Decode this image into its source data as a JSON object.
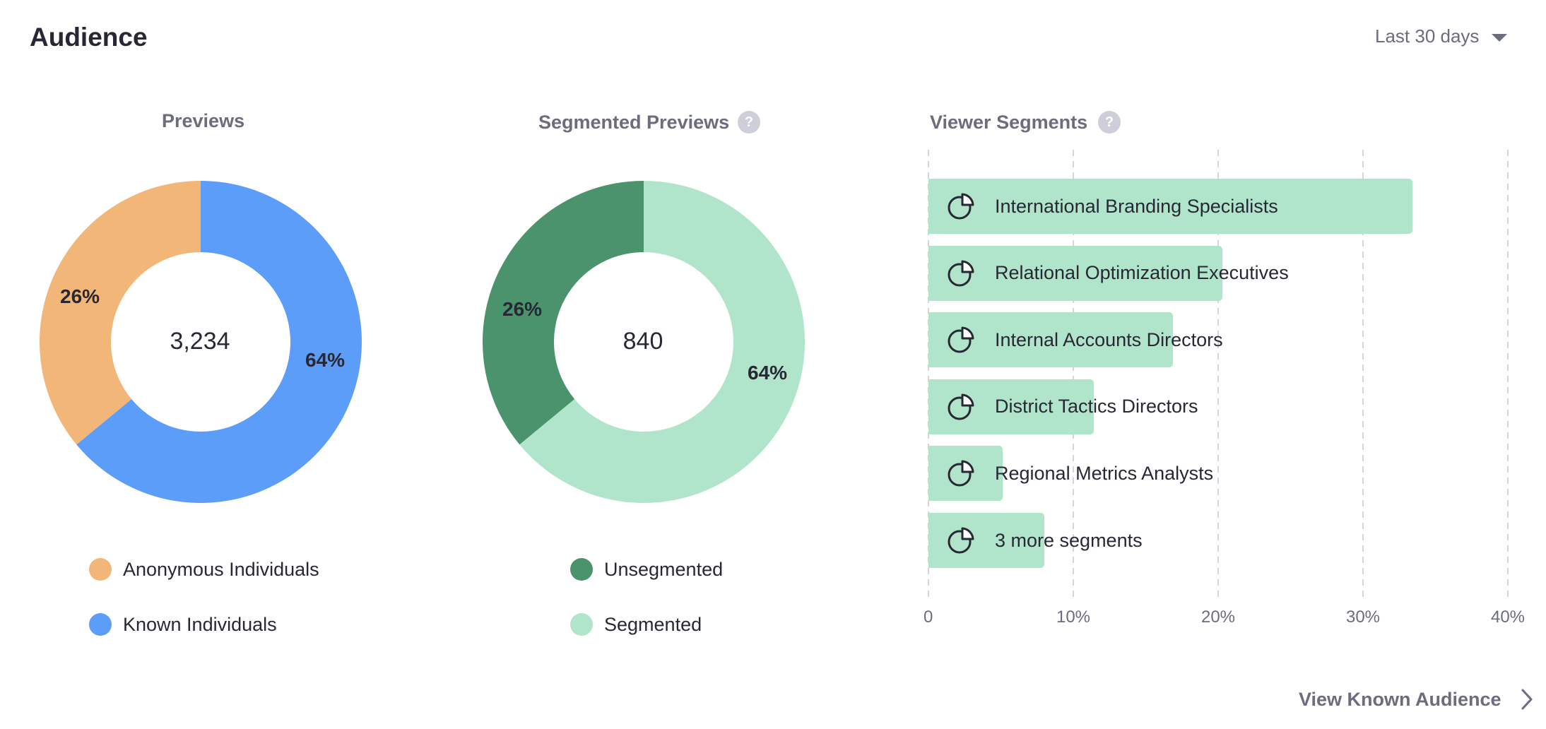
{
  "header": {
    "title": "Audience",
    "range_label": "Last 30 days"
  },
  "previews": {
    "title": "Previews",
    "total": "3,234",
    "slices": [
      {
        "name": "Anonymous Individuals",
        "label": "26%",
        "value": 36,
        "color": "#f3b679"
      },
      {
        "name": "Known Individuals",
        "label": "64%",
        "value": 64,
        "color": "#5c9dfa"
      }
    ]
  },
  "segmented": {
    "title": "Segmented Previews",
    "help": "?",
    "total": "840",
    "slices": [
      {
        "name": "Unsegmented",
        "label": "26%",
        "value": 36,
        "color": "#4b936c"
      },
      {
        "name": "Segmented",
        "label": "64%",
        "value": 64,
        "color": "#b0e5cc"
      }
    ]
  },
  "viewer_segments": {
    "title": "Viewer Segments",
    "help": "?",
    "bar_color": "#b0e5cc"
  },
  "chart_data": {
    "type": "bar",
    "orientation": "horizontal",
    "categories": [
      "International Branding Specialists",
      "Relational Optimization Executives",
      "Internal Accounts Directors",
      "District Tactics Directors",
      "Regional Metrics Analysts",
      "3 more segments"
    ],
    "values": [
      33.4,
      20.3,
      16.9,
      11.4,
      5.1,
      8.0
    ],
    "xlim": [
      0,
      40
    ],
    "x_ticks": [
      "0",
      "10%",
      "20%",
      "30%",
      "40%"
    ],
    "grid": true
  },
  "footer": {
    "link_label": "View Known Audience"
  }
}
